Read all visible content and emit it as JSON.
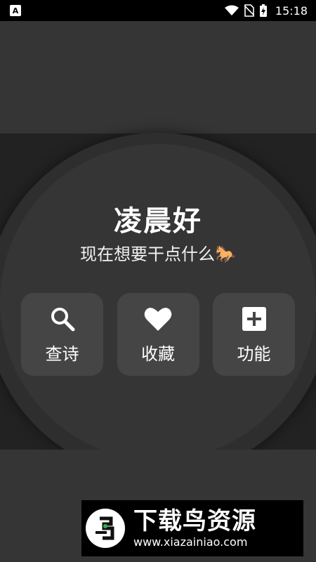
{
  "status_bar": {
    "app_badge": "A",
    "time": "15:18"
  },
  "main": {
    "greeting": "凌晨好",
    "subtitle": "现在想要干点什么",
    "subtitle_emoji": "🐎",
    "actions": [
      {
        "label": "查诗",
        "icon": "search-icon"
      },
      {
        "label": "收藏",
        "icon": "heart-icon"
      },
      {
        "label": "功能",
        "icon": "plus-square-icon"
      }
    ]
  },
  "watermark": {
    "title": "下载鸟资源",
    "url": "www.xiazainiao.com"
  },
  "colors": {
    "background": "#353535",
    "band": "#222222",
    "button": "#454545",
    "text": "#ffffff"
  }
}
